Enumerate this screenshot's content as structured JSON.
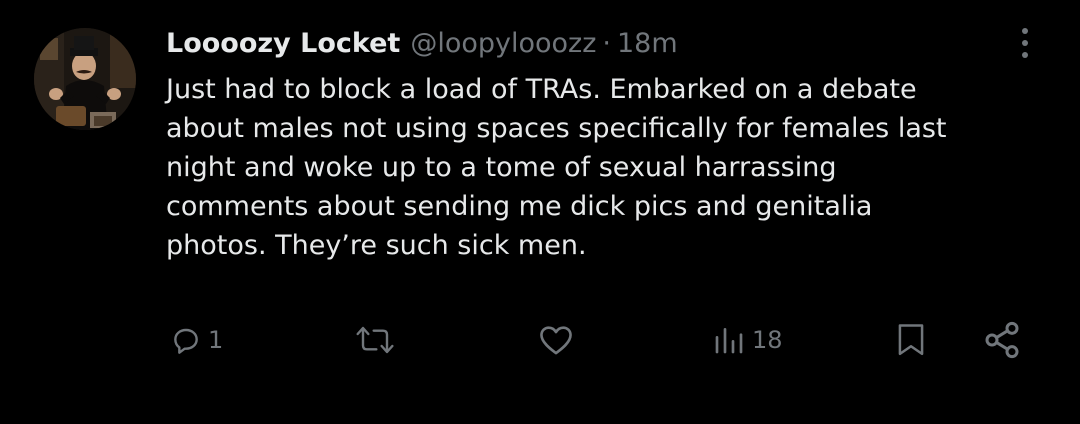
{
  "author": {
    "display_name": "Loooozy Locket",
    "handle": "@loopylooozz",
    "separator": "·",
    "time": "18m"
  },
  "tweet": {
    "text": "Just had to block a load of TRAs. Embarked on a debate\nabout males not using spaces specifically for females last\nnight and woke up to a tome of sexual harrassing\ncomments about sending me dick pics and genitalia\nphotos. They’re such sick men."
  },
  "actions": {
    "reply": {
      "icon": "reply-icon",
      "count": "1"
    },
    "retweet": {
      "icon": "retweet-icon",
      "count": ""
    },
    "like": {
      "icon": "heart-icon",
      "count": ""
    },
    "views": {
      "icon": "views-icon",
      "count": "18"
    },
    "bookmark": {
      "icon": "bookmark-icon"
    },
    "share": {
      "icon": "share-icon"
    }
  },
  "colors": {
    "background": "#000000",
    "text_primary": "#e7e9ea",
    "text_secondary": "#71767b"
  }
}
